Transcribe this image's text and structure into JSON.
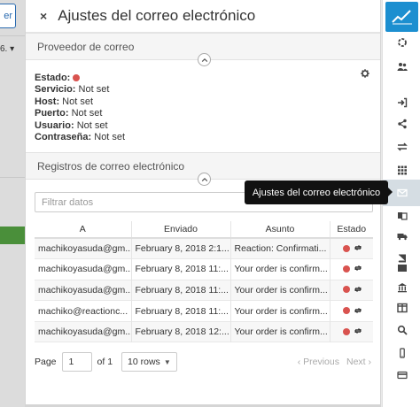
{
  "background": {
    "button_label": "er",
    "select_label": "6. ▾"
  },
  "panel": {
    "title": "Ajustes del correo electrónico",
    "close_glyph": "×"
  },
  "provider": {
    "section_title": "Proveedor de correo",
    "status_label": "Estado:",
    "status_color": "#d9534f",
    "fields": [
      {
        "label": "Servicio:",
        "value": "Not set"
      },
      {
        "label": "Host:",
        "value": "Not set"
      },
      {
        "label": "Puerto:",
        "value": "Not set"
      },
      {
        "label": "Usuario:",
        "value": "Not set"
      },
      {
        "label": "Contraseña:",
        "value": " Not set"
      }
    ],
    "settings_icon": "gear-icon"
  },
  "logs": {
    "section_title": "Registros de correo electrónico",
    "filter_placeholder": "Filtrar datos",
    "columns": [
      "A",
      "Enviado",
      "Asunto",
      "Estado"
    ],
    "rows": [
      {
        "to": "machikoyasuda@gm...",
        "sent": "February 8, 2018 2:1...",
        "subject": "Reaction: Confirmati...",
        "status_color": "#d9534f"
      },
      {
        "to": "machikoyasuda@gm...",
        "sent": "February 8, 2018 11:...",
        "subject": "Your order is confirm...",
        "status_color": "#d9534f"
      },
      {
        "to": "machikoyasuda@gm...",
        "sent": "February 8, 2018 11:...",
        "subject": "Your order is confirm...",
        "status_color": "#d9534f"
      },
      {
        "to": "machiko@reactionc...",
        "sent": "February 8, 2018 11:...",
        "subject": "Your order is confirm...",
        "status_color": "#d9534f"
      },
      {
        "to": "machikoyasuda@gm...",
        "sent": "February 8, 2018 12:...",
        "subject": "Your order is confirm...",
        "status_color": "#d9534f"
      }
    ],
    "pager": {
      "page_label": "Page",
      "page_value": "1",
      "of_label": "of 1",
      "rows_label": "10 rows",
      "previous_label": "‹ Previous",
      "next_label": "Next ›"
    }
  },
  "tooltip": {
    "text": "Ajustes del correo electrónico"
  },
  "sidebar": {
    "icons": [
      "logo-chart-icon",
      "circle-notch-icon",
      "users-icon",
      "sign-in-icon",
      "share-icon",
      "exchange-icon",
      "grid-icon",
      "envelope-icon",
      "language-icon",
      "truck-icon",
      "book-icon",
      "box-icon",
      "bank-icon",
      "columns-icon",
      "search-icon",
      "mobile-icon",
      "credit-card-icon"
    ]
  }
}
